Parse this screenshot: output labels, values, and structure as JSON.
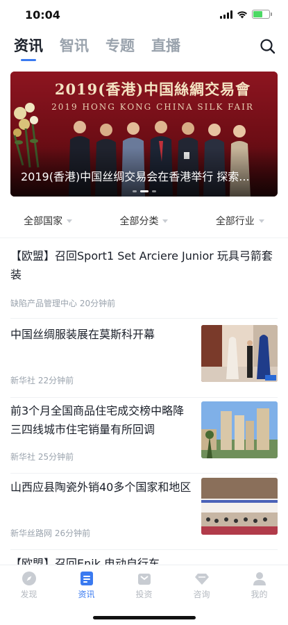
{
  "status": {
    "time": "10:04"
  },
  "tabs": [
    {
      "label": "资讯",
      "active": true
    },
    {
      "label": "智讯",
      "active": false
    },
    {
      "label": "专题",
      "active": false
    },
    {
      "label": "直播",
      "active": false
    }
  ],
  "banner": {
    "sign_line1": "2019(香港)中国絲綢交易會",
    "sign_line2": "2019 HONG KONG CHINA SILK FAIR",
    "caption": "2019(香港)中国丝绸交易会在香港举行 探索...",
    "dots": 3,
    "active_dot": 1
  },
  "filters": [
    {
      "label": "全部国家"
    },
    {
      "label": "全部分类"
    },
    {
      "label": "全部行业"
    }
  ],
  "news": [
    {
      "title": "【欧盟】召回Sport1 Set Arciere Junior 玩具弓箭套装",
      "source": "缺陷产品管理中心",
      "time": "20分钟前",
      "has_image": false
    },
    {
      "title": "中国丝绸服装展在莫斯科开幕",
      "source": "新华社",
      "time": "22分钟前",
      "has_image": true
    },
    {
      "title": "前3个月全国商品住宅成交榜中略降 三四线城市住宅销量有所回调",
      "source": "新华社",
      "time": "25分钟前",
      "has_image": true
    },
    {
      "title": "山西应县陶瓷外销40多个国家和地区",
      "source": "新华丝路网",
      "time": "26分钟前",
      "has_image": true
    },
    {
      "title": "【欧盟】召回Enik 电动自行车",
      "source": "",
      "time": "",
      "has_image": false
    }
  ],
  "tabbar": [
    {
      "label": "发现",
      "icon": "compass-icon",
      "active": false
    },
    {
      "label": "资讯",
      "icon": "news-icon",
      "active": true
    },
    {
      "label": "投资",
      "icon": "briefcase-icon",
      "active": false
    },
    {
      "label": "咨询",
      "icon": "diamond-icon",
      "active": false
    },
    {
      "label": "我的",
      "icon": "user-icon",
      "active": false
    }
  ],
  "colors": {
    "accent": "#3a7af0",
    "muted": "#9aa3ad",
    "banner_red": "#7a1018"
  }
}
